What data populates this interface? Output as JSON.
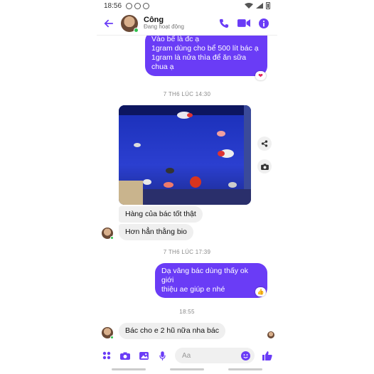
{
  "status": {
    "time": "18:56"
  },
  "header": {
    "name": "Công",
    "presence": "Đang hoạt động"
  },
  "messages": {
    "out1_lines": [
      "Vào bể là đc ạ",
      "1gram dùng cho bể 500 lít bác ạ",
      "1gram là nửa thìa để ăn sữa",
      "chua ạ"
    ],
    "out1_reaction": "❤",
    "ts1": "7 TH6 LÚC 14:30",
    "in1": "Hàng của bác tốt thật",
    "in2": "Hơn hẳn thằng bio",
    "ts2": "7 TH6 LÚC 17:39",
    "out2_lines": [
      "Dạ vâng bác dùng thấy ok giới",
      "thiệu ae giúp e nhé"
    ],
    "out2_reaction": "👍",
    "ts3": "18:55",
    "in3": "Bác cho e 2 hũ nữa nha bác"
  },
  "composer": {
    "placeholder": "Aa"
  },
  "colors": {
    "accent": "#6a3cf6",
    "bubble_in": "#efefef",
    "online": "#31c150"
  },
  "icons": [
    "back-arrow-icon",
    "phone-icon",
    "video-icon",
    "info-icon",
    "share-icon",
    "camera-icon",
    "apps-icon",
    "gallery-icon",
    "mic-icon",
    "emoji-icon",
    "like-icon"
  ]
}
